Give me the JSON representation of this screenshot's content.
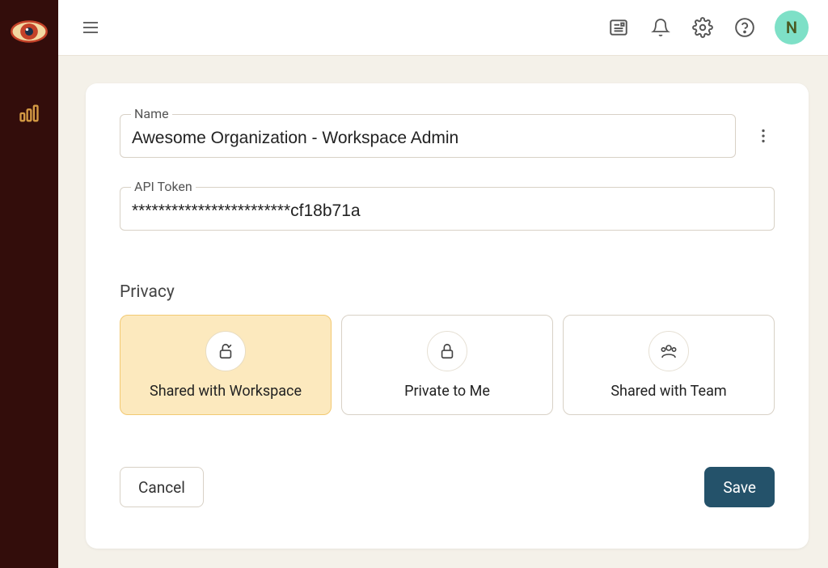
{
  "avatar": {
    "initial": "N"
  },
  "form": {
    "name_label": "Name",
    "name_value": "Awesome Organization - Workspace Admin",
    "token_label": "API Token",
    "token_value": "************************cf18b71a"
  },
  "privacy": {
    "section_title": "Privacy",
    "options": [
      {
        "label": "Shared with Workspace"
      },
      {
        "label": "Private to Me"
      },
      {
        "label": "Shared with Team"
      }
    ]
  },
  "buttons": {
    "cancel": "Cancel",
    "save": "Save"
  }
}
